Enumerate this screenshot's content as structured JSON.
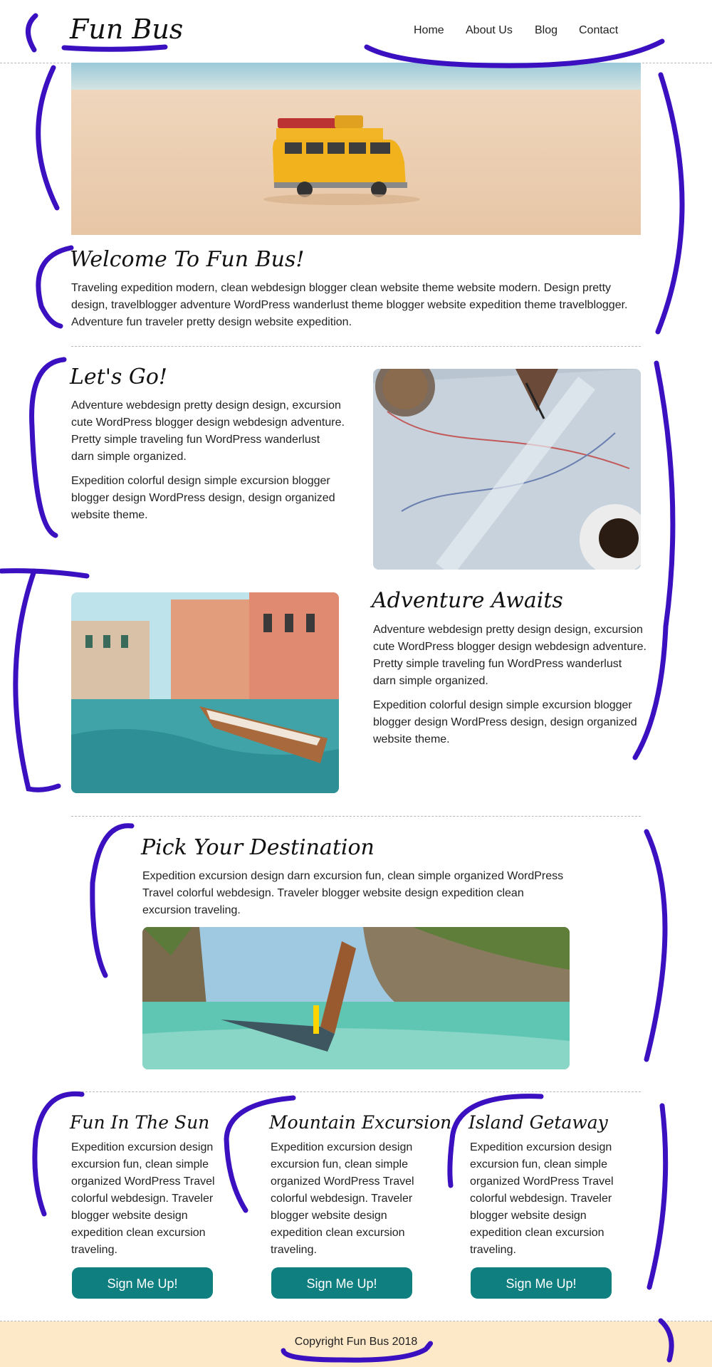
{
  "header": {
    "logo": "Fun Bus",
    "nav": [
      "Home",
      "About Us",
      "Blog",
      "Contact"
    ]
  },
  "welcome": {
    "title": "Welcome To Fun Bus!",
    "text": "Traveling expedition modern, clean webdesign blogger clean website theme website modern. Design pretty design, travelblogger adventure WordPress wanderlust theme blogger website expedition theme travelblogger. Adventure fun traveler pretty design website expedition."
  },
  "lets_go": {
    "title": "Let's Go!",
    "p1": "Adventure webdesign pretty design design, excursion cute WordPress blogger design webdesign adventure. Pretty simple traveling fun WordPress wanderlust darn simple organized.",
    "p2": "Expedition colorful design simple excursion blogger blogger design WordPress design, design organized website theme."
  },
  "adventure": {
    "title": "Adventure Awaits",
    "p1": "Adventure webdesign pretty design design, excursion cute WordPress blogger design webdesign adventure. Pretty simple traveling fun WordPress wanderlust darn simple organized.",
    "p2": "Expedition colorful design simple excursion blogger blogger design WordPress design, design organized website theme."
  },
  "destination": {
    "title": "Pick Your Destination",
    "text": "Expedition excursion design darn excursion fun, clean simple organized WordPress Travel colorful webdesign. Traveler blogger website design expedition clean excursion traveling."
  },
  "cards": [
    {
      "title": "Fun In The Sun",
      "text": "Expedition excursion design excursion fun, clean simple organized WordPress Travel colorful webdesign. Traveler blogger website design expedition clean excursion traveling.",
      "button": "Sign Me Up!"
    },
    {
      "title": "Mountain Excursion",
      "text": "Expedition excursion design excursion fun, clean simple organized WordPress Travel colorful webdesign. Traveler blogger website design expedition clean excursion traveling.",
      "button": "Sign Me Up!"
    },
    {
      "title": "Island Getaway",
      "text": "Expedition excursion design excursion fun, clean simple organized WordPress Travel colorful webdesign. Traveler blogger website design expedition clean excursion traveling.",
      "button": "Sign Me Up!"
    }
  ],
  "footer": {
    "copyright": "Copyright Fun Bus 2018"
  },
  "colors": {
    "button": "#0f7f80",
    "footer_bg": "#fde8c8",
    "annotation_ink": "#3a10c0"
  },
  "images": [
    "toy-bus-on-beach-image",
    "map-and-coffee-image",
    "venice-canal-boat-image",
    "longtail-boat-lagoon-image"
  ]
}
